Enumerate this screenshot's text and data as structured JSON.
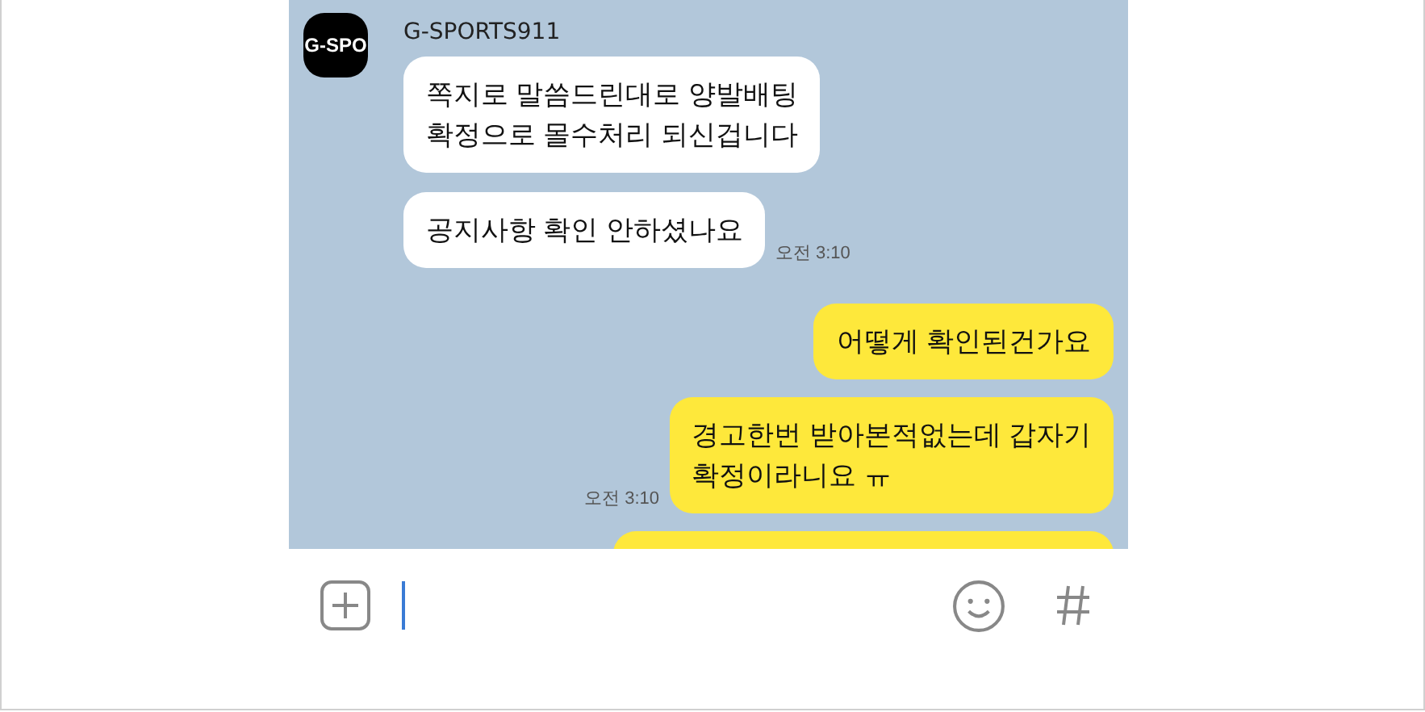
{
  "chat": {
    "groups": [
      {
        "kind": "received",
        "sender": "G-SPORTS911",
        "avatar_text": "G-SPO",
        "bubbles": [
          {
            "text": "쪽지로 말씀드린대로 양발배팅\n확정으로 몰수처리 되신겁니다"
          },
          {
            "text": "공지사항 확인 안하셨나요",
            "time": "오전 3:10"
          }
        ]
      },
      {
        "kind": "sent",
        "bubbles": [
          {
            "text": "어떻게 확인된건가요"
          },
          {
            "text": "경고한번 받아본적없는데 갑자기\n확정이라니요 ㅠ",
            "time": "오전 3:10"
          }
        ],
        "cut_off_bubble": true
      }
    ]
  },
  "input_bar": {
    "cursor": true
  }
}
